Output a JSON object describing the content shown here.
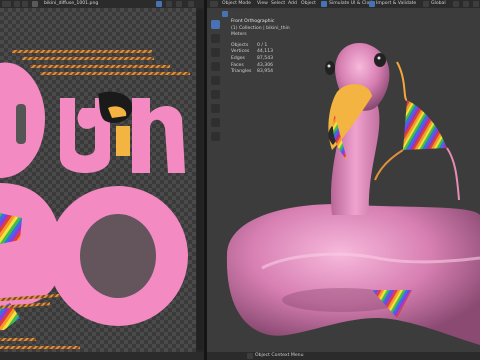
{
  "image_editor": {
    "filename": "bikini_diffuse_1001.png",
    "status_text": ""
  },
  "viewport": {
    "mode_label": "Object Mode",
    "menu": [
      "View",
      "Select",
      "Add",
      "Object"
    ],
    "addon_buttons": [
      "Simulate UI & Cloth",
      "Import & Validate"
    ],
    "global_label": "Global",
    "overlay": {
      "view_name": "Front Orthographic",
      "collection": "(1) Collection | bikini_thin",
      "units": "Meters",
      "stats": [
        {
          "label": "Objects",
          "value": "0 / 1"
        },
        {
          "label": "Vertices",
          "value": "44,113"
        },
        {
          "label": "Edges",
          "value": "87,543"
        },
        {
          "label": "Faces",
          "value": "43,306"
        },
        {
          "label": "Triangles",
          "value": "83,954"
        }
      ]
    },
    "status_text": "Object Context Menu"
  },
  "colors": {
    "accent": "#4772b3",
    "flamingo_pink": "#f38ac2",
    "beak_yellow": "#f3b441"
  }
}
